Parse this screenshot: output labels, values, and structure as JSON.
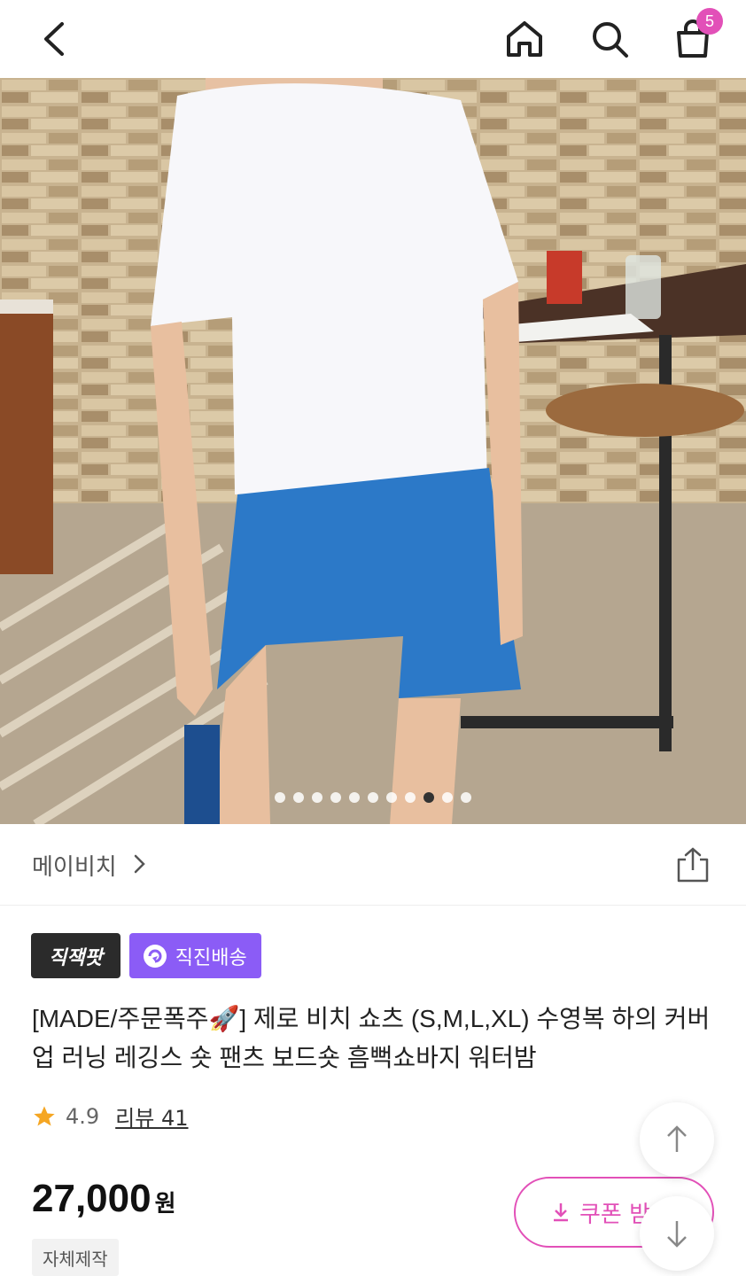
{
  "header": {
    "back_icon": "chevron-left-icon",
    "home_icon": "home-icon",
    "search_icon": "search-icon",
    "cart_icon": "shopping-bag-icon",
    "cart_count": "5"
  },
  "gallery": {
    "image_count": 11,
    "active_index": 8
  },
  "shop": {
    "name": "메이비치",
    "share_icon": "share-icon"
  },
  "badges": {
    "brand": "직잭팟",
    "delivery": "직진배송"
  },
  "product": {
    "title": "[MADE/주문폭주🚀] 제로 비치 쇼츠 (S,M,L,XL) 수영복 하의 커버업 러닝 레깅스 숏 팬츠 보드숏 흠뻑쇼바지 워터밤",
    "rating": "4.9",
    "review_label": "리뷰 41",
    "price": "27,000",
    "price_unit": "원",
    "coupon_label": "쿠폰 받",
    "tag": "자체제작"
  },
  "colors": {
    "accent": "#e250b8",
    "delivery_badge": "#8b5cf6",
    "brand_badge": "#2b2b2b",
    "star": "#f5a623"
  }
}
